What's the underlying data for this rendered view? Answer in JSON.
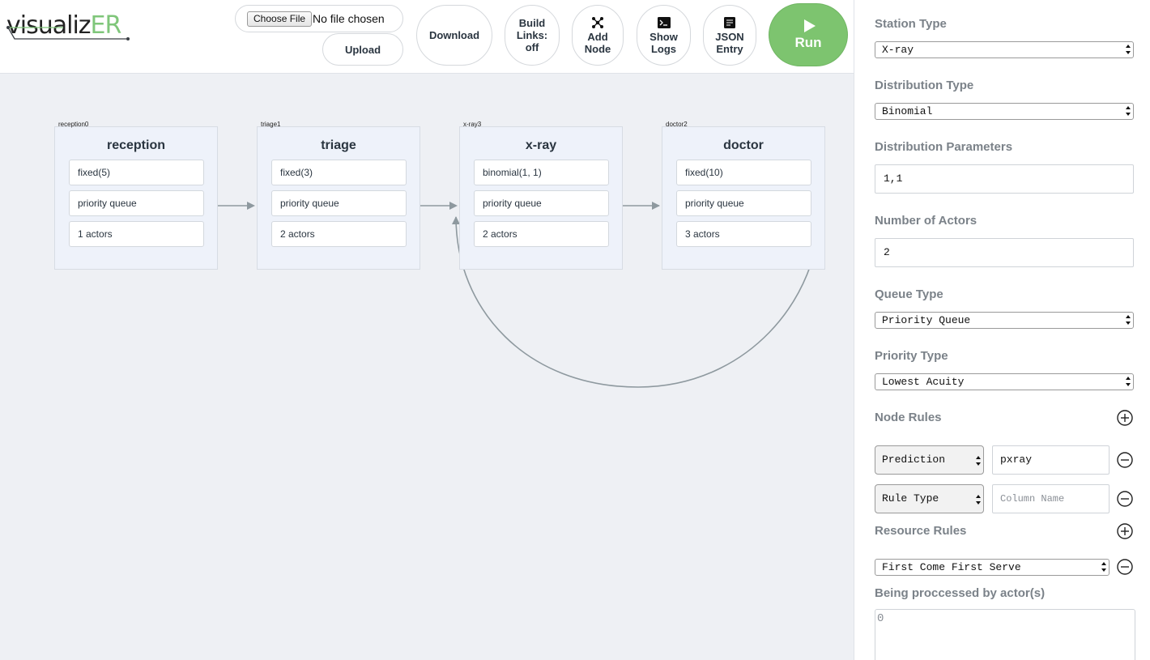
{
  "app": {
    "logo_part1": "visualiz",
    "logo_part2": "ER"
  },
  "toolbar": {
    "choose_file_label": "Choose File",
    "file_status": "No file chosen",
    "upload_label": "Upload",
    "download_label": "Download",
    "build_links_line1": "Build",
    "build_links_line2": "Links:",
    "build_links_line3": "off",
    "add_node_line1": "Add",
    "add_node_line2": "Node",
    "show_logs_line1": "Show",
    "show_logs_line2": "Logs",
    "json_entry_line1": "JSON",
    "json_entry_line2": "Entry",
    "run_label": "Run",
    "icons": [
      "add-node-icon",
      "terminal-icon",
      "json-entry-icon",
      "play-icon"
    ]
  },
  "nodes": [
    {
      "id": "reception0",
      "title": "reception",
      "distribution": "fixed(5)",
      "queue": "priority queue",
      "actors": "1 actors"
    },
    {
      "id": "triage1",
      "title": "triage",
      "distribution": "fixed(3)",
      "queue": "priority queue",
      "actors": "2 actors"
    },
    {
      "id": "x-ray3",
      "title": "x-ray",
      "distribution": "binomial(1, 1)",
      "queue": "priority queue",
      "actors": "2 actors"
    },
    {
      "id": "doctor2",
      "title": "doctor",
      "distribution": "fixed(10)",
      "queue": "priority queue",
      "actors": "3 actors"
    }
  ],
  "panel": {
    "station_type_label": "Station Type",
    "station_type_value": "X-ray",
    "distribution_type_label": "Distribution Type",
    "distribution_type_value": "Binomial",
    "distribution_params_label": "Distribution Parameters",
    "distribution_params_value": "1,1",
    "num_actors_label": "Number of Actors",
    "num_actors_value": "2",
    "queue_type_label": "Queue Type",
    "queue_type_value": "Priority Queue",
    "priority_type_label": "Priority Type",
    "priority_type_value": "Lowest Acuity",
    "node_rules_label": "Node Rules",
    "rule1_type": "Prediction",
    "rule1_value": "pxray",
    "rule2_type": "Rule Type",
    "rule2_placeholder": "Column Name",
    "resource_rules_label": "Resource Rules",
    "resource_rule_value": "First Come First Serve",
    "processed_by_label": "Being proccessed by actor(s)",
    "processed_by_value": "0"
  },
  "colors": {
    "run_green": "#7dc46f",
    "logo_green": "#7fc67a",
    "node_bg": "#eef2fa",
    "link_gray": "#8e999f"
  }
}
